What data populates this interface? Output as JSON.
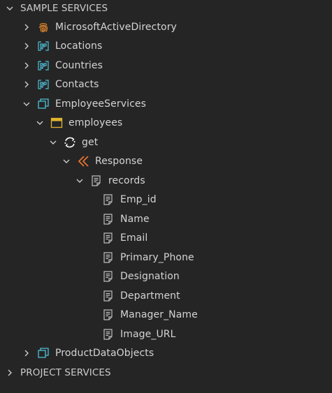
{
  "sections": {
    "sample": {
      "label": "SAMPLE SERVICES",
      "expanded": true
    },
    "project": {
      "label": "PROJECT SERVICES",
      "expanded": false
    }
  },
  "nodes": {
    "microsoft_ad": {
      "label": "MicrosoftActiveDirectory",
      "icon": "fingerprint-icon"
    },
    "locations": {
      "label": "Locations",
      "icon": "data-object-icon"
    },
    "countries": {
      "label": "Countries",
      "icon": "data-object-icon"
    },
    "contacts": {
      "label": "Contacts",
      "icon": "data-object-icon"
    },
    "employee_services": {
      "label": "EmployeeServices",
      "icon": "service-icon"
    },
    "employees": {
      "label": "employees",
      "icon": "resource-icon"
    },
    "get": {
      "label": "get",
      "icon": "get-method-icon"
    },
    "response": {
      "label": "Response",
      "icon": "response-icon"
    },
    "records": {
      "label": "records",
      "icon": "document-icon"
    },
    "fields": [
      {
        "label": "Emp_id"
      },
      {
        "label": "Name"
      },
      {
        "label": "Email"
      },
      {
        "label": "Primary_Phone"
      },
      {
        "label": "Designation"
      },
      {
        "label": "Department"
      },
      {
        "label": "Manager_Name"
      },
      {
        "label": "Image_URL"
      }
    ],
    "product_data_objects": {
      "label": "ProductDataObjects",
      "icon": "service-icon"
    }
  },
  "colors": {
    "background": "#252526",
    "text": "#d4d4d4",
    "fingerprint": "#d9822b",
    "service_blue": "#4fc1d6",
    "resource_yellow": "#e0b52e",
    "response_orange": "#e5732c",
    "document_gray": "#bdbdbd"
  }
}
